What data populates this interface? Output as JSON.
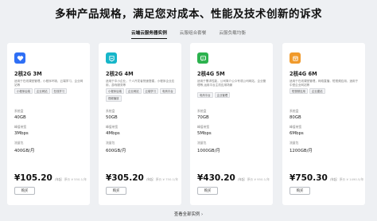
{
  "page_title": "多种产品规格，满足您对成本、性能及技术创新的诉求",
  "tabs": [
    {
      "label": "云端云服务器实例",
      "active": true
    },
    {
      "label": "云服组合套餐",
      "active": false
    },
    {
      "label": "云服负载均衡",
      "active": false
    }
  ],
  "labels": {
    "storage": "系统盘",
    "bandwidth": "峰值带宽",
    "traffic": "流量包",
    "buy": "购买",
    "unit": "/年起",
    "view_all": "查看全部实例 ›"
  },
  "cards": [
    {
      "color": "#2f6ff5",
      "icon": "heart-icon",
      "name": "2核2G 3M",
      "desc": "适用于在线课堂管理，小程序环境，云端学习，企业网站等",
      "tags": [
        "小程序后端",
        "企业网站",
        "在线学习"
      ],
      "storage": "40GB",
      "bandwidth": "3Mbps",
      "traffic": "400GB/月",
      "price": "¥105.20",
      "original": "原价 ¥ 550.1/年"
    },
    {
      "color": "#16b6c9",
      "icon": "smile-icon",
      "name": "2核2G 4M",
      "desc": "适用于中小企业，个人开发者快速搭建，小程序企业应用，游戏服务等",
      "tags": [
        "小程序后端",
        "企业网站",
        "云端学习",
        "电商平台",
        "视频播放"
      ],
      "storage": "50GB",
      "bandwidth": "4Mbps",
      "traffic": "600GB/月",
      "price": "¥305.20",
      "original": "原价 ¥ 750.1/年"
    },
    {
      "color": "#2cb24e",
      "icon": "chat-icon",
      "name": "2核4G 5M",
      "desc": "适用于需求性能，公司简介公众号或公司网站，企业管理等,运用平台主机应用场景",
      "tags": [
        "电商平台",
        "企业管理"
      ],
      "storage": "70GB",
      "bandwidth": "5Mbps",
      "traffic": "1000GB/月",
      "price": "¥430.20",
      "original": "原价 ¥ 950.1/年"
    },
    {
      "color": "#f09a2c",
      "icon": "box-icon",
      "name": "2核4G 6M",
      "desc": "适用于在线课堂管理，网络直播，短视频应用，适用于中型企业网站等",
      "tags": [
        "短视频应用",
        "企业建站"
      ],
      "storage": "80GB",
      "bandwidth": "6Mbps",
      "traffic": "1200GB/月",
      "price": "¥750.30",
      "original": "原价 ¥ 1490.5/年"
    }
  ]
}
